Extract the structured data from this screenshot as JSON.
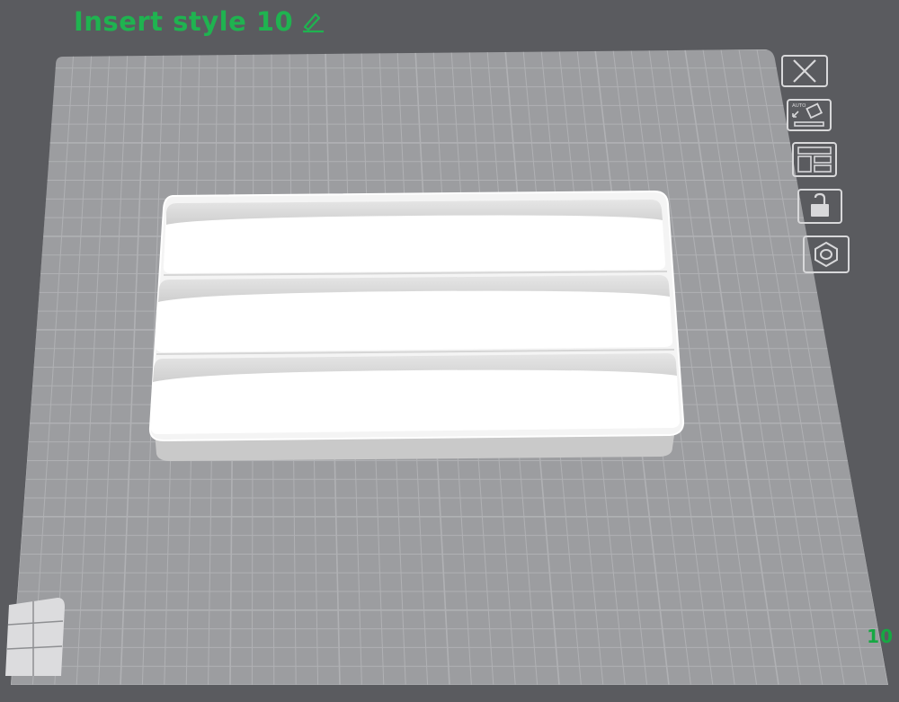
{
  "header": {
    "title": "Insert style 10",
    "edit_icon": "pencil-icon",
    "title_color": "#1fb350"
  },
  "toolbar": {
    "buttons": [
      {
        "icon": "close-icon"
      },
      {
        "icon": "auto-arrange-icon",
        "label": "AUTO"
      },
      {
        "icon": "layout-icon"
      },
      {
        "icon": "unlock-icon"
      },
      {
        "icon": "hex-nut-icon"
      }
    ]
  },
  "viewport": {
    "plate_color": "#9c9da0",
    "grid_color": "#b8b9bc",
    "model": "3-compartment tray insert"
  },
  "footer": {
    "layer_count": "10",
    "layer_color": "#16a843"
  }
}
